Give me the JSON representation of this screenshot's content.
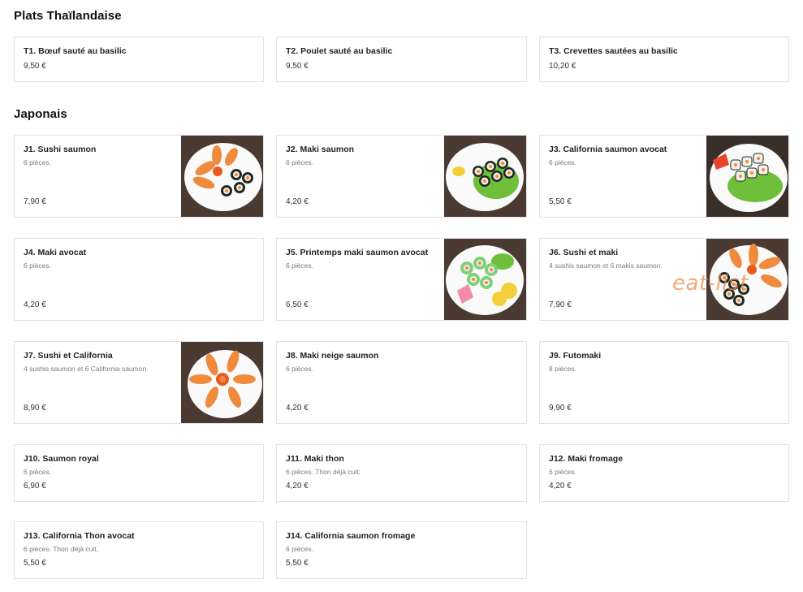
{
  "sections": {
    "thai_title": "Plats Thaïlandaise",
    "japanese_title": "Japonais"
  },
  "thai_items": [
    {
      "name": "T1. Bœuf sauté au basilic",
      "price": "9,50 €"
    },
    {
      "name": "T2. Poulet sauté au basilic",
      "price": "9,50 €"
    },
    {
      "name": "T3. Crevettes sautées au basilic",
      "price": "10,20 €"
    }
  ],
  "japanese_items": [
    {
      "name": "J1. Sushi saumon",
      "desc": "6 pièces.",
      "price": "7,90 €",
      "image": "sushi-salmon-plate"
    },
    {
      "name": "J2. Maki saumon",
      "desc": "6 pièces.",
      "price": "4,20 €",
      "image": "maki-salmon-plate"
    },
    {
      "name": "J3. California saumon avocat",
      "desc": "6 pièces.",
      "price": "5,50 €",
      "image": "california-roll-plate"
    },
    {
      "name": "J4. Maki avocat",
      "desc": "6 pièces.",
      "price": "4,20 €"
    },
    {
      "name": "J5. Printemps maki saumon avocat",
      "desc": "6 pièces.",
      "price": "6,50 €",
      "image": "spring-maki-plate"
    },
    {
      "name": "J6. Sushi et maki",
      "desc": "4 sushis saumon et 6 makis saumon.",
      "price": "7,90 €",
      "image": "sushi-maki-plate"
    },
    {
      "name": "J7. Sushi et California",
      "desc": "4 sushis saumon et 6 California saumon.",
      "price": "8,90 €",
      "image": "sushi-california-plate"
    },
    {
      "name": "J8. Maki neige saumon",
      "desc": "6 pièces.",
      "price": "4,20 €"
    },
    {
      "name": "J9. Futomaki",
      "desc": "8 pièces.",
      "price": "9,90 €"
    },
    {
      "name": "J10. Saumon royal",
      "desc": "6 pièces.",
      "price": "6,90 €"
    },
    {
      "name": "J11. Maki thon",
      "desc": "6 pièces. Thon déjà cuit;",
      "price": "4,20 €"
    },
    {
      "name": "J12. Maki fromage",
      "desc": "6 pièces.",
      "price": "4,20 €"
    },
    {
      "name": "J13. California Thon avocat",
      "desc": "6 pièces. Thon déjà cuit.",
      "price": "5,50 €"
    },
    {
      "name": "J14. California saumon fromage",
      "desc": "6 pièces.",
      "price": "5,50 €"
    }
  ],
  "watermark": "eat-list",
  "colors": {
    "salmon": "#f08a3c",
    "rice": "#f4f1ea",
    "nori": "#1f2a22",
    "lettuce": "#6fbf3a",
    "lemon": "#f5cf3a",
    "table": "#4a3a32"
  }
}
